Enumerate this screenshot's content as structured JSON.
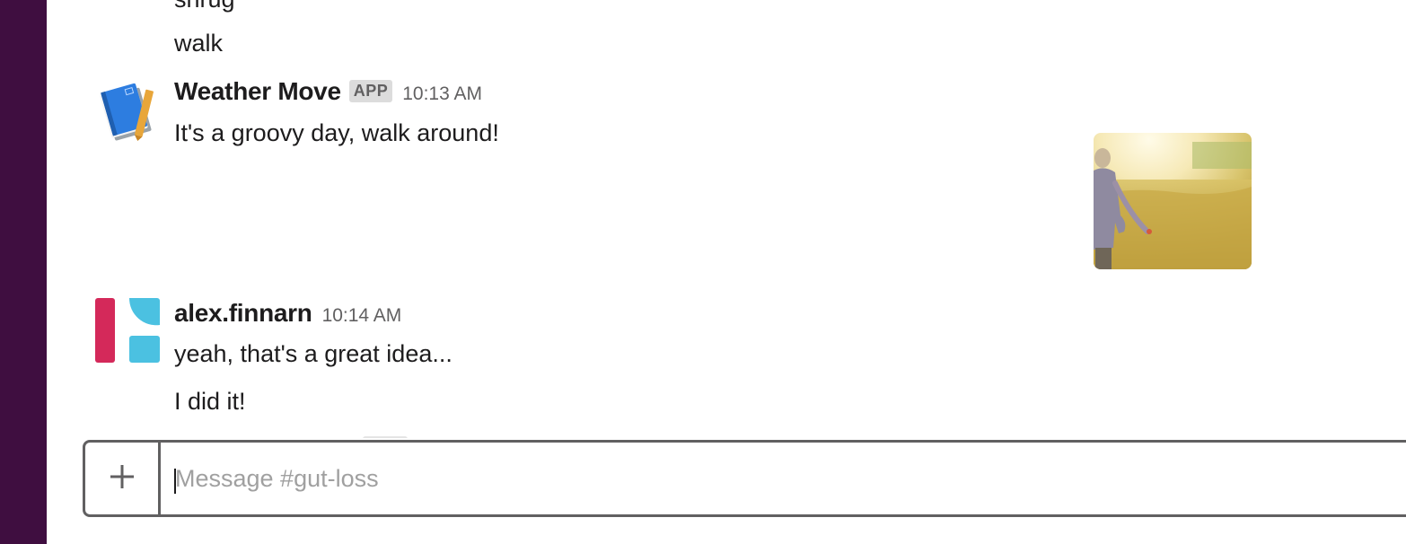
{
  "sidebar": {
    "color": "#3f0e40"
  },
  "messages": {
    "clipped_text": "shrug",
    "walk_text": "walk",
    "weather": {
      "sender": "Weather Move",
      "badge": "APP",
      "time": "10:13 AM",
      "text": "It's a groovy day, walk around!",
      "avatar_icon": "notebook-icon",
      "attachment_icon": "meadow-photo"
    },
    "alex": {
      "sender": "alex.finnarn",
      "time": "10:14 AM",
      "lines": [
        "yeah, that's a great idea...",
        "I did it!"
      ],
      "avatar_icon": "pink-blue-blocks-avatar"
    }
  },
  "composer": {
    "placeholder": "Message #gut-loss",
    "value": "",
    "plus_icon": "plus-icon"
  }
}
